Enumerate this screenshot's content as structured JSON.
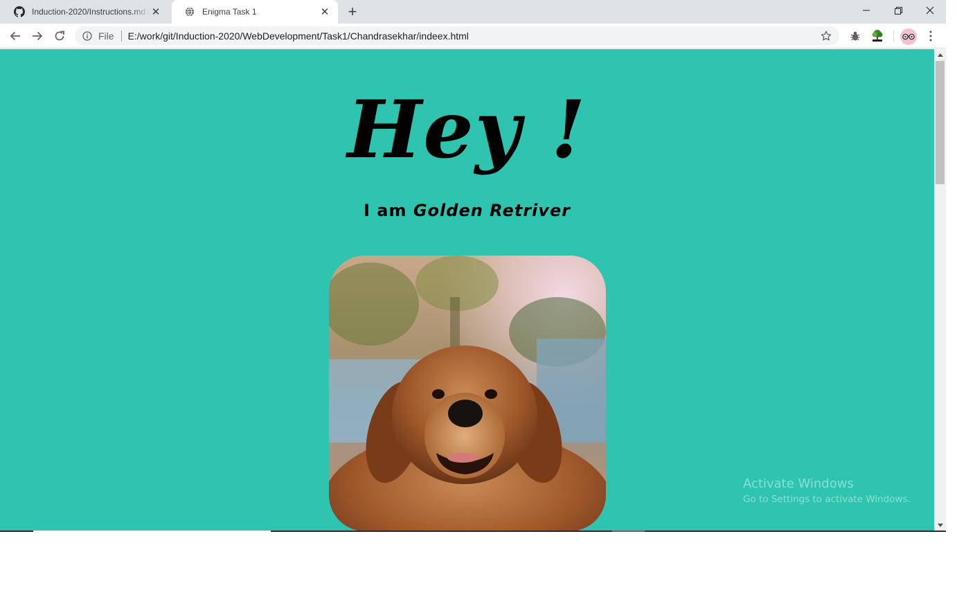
{
  "browser": {
    "tabs": [
      {
        "title": "Induction-2020/Instructions.md at",
        "favicon": "github-icon",
        "active": false
      },
      {
        "title": "Enigma Task 1",
        "favicon": "globe-icon",
        "active": true
      }
    ],
    "address": {
      "scheme_label": "File",
      "url": "E:/work/git/Induction-2020/WebDevelopment/Task1/Chandrasekhar/indeex.html"
    }
  },
  "page": {
    "heading": "Hey !",
    "subtitle_prefix": "I am",
    "subtitle_breed": "Golden Retriver",
    "photo_subject": "golden-retriever-photo",
    "background_color": "#2ec4b0"
  },
  "watermark": {
    "line1": "Activate Windows",
    "line2": "Go to Settings to activate Windows."
  }
}
